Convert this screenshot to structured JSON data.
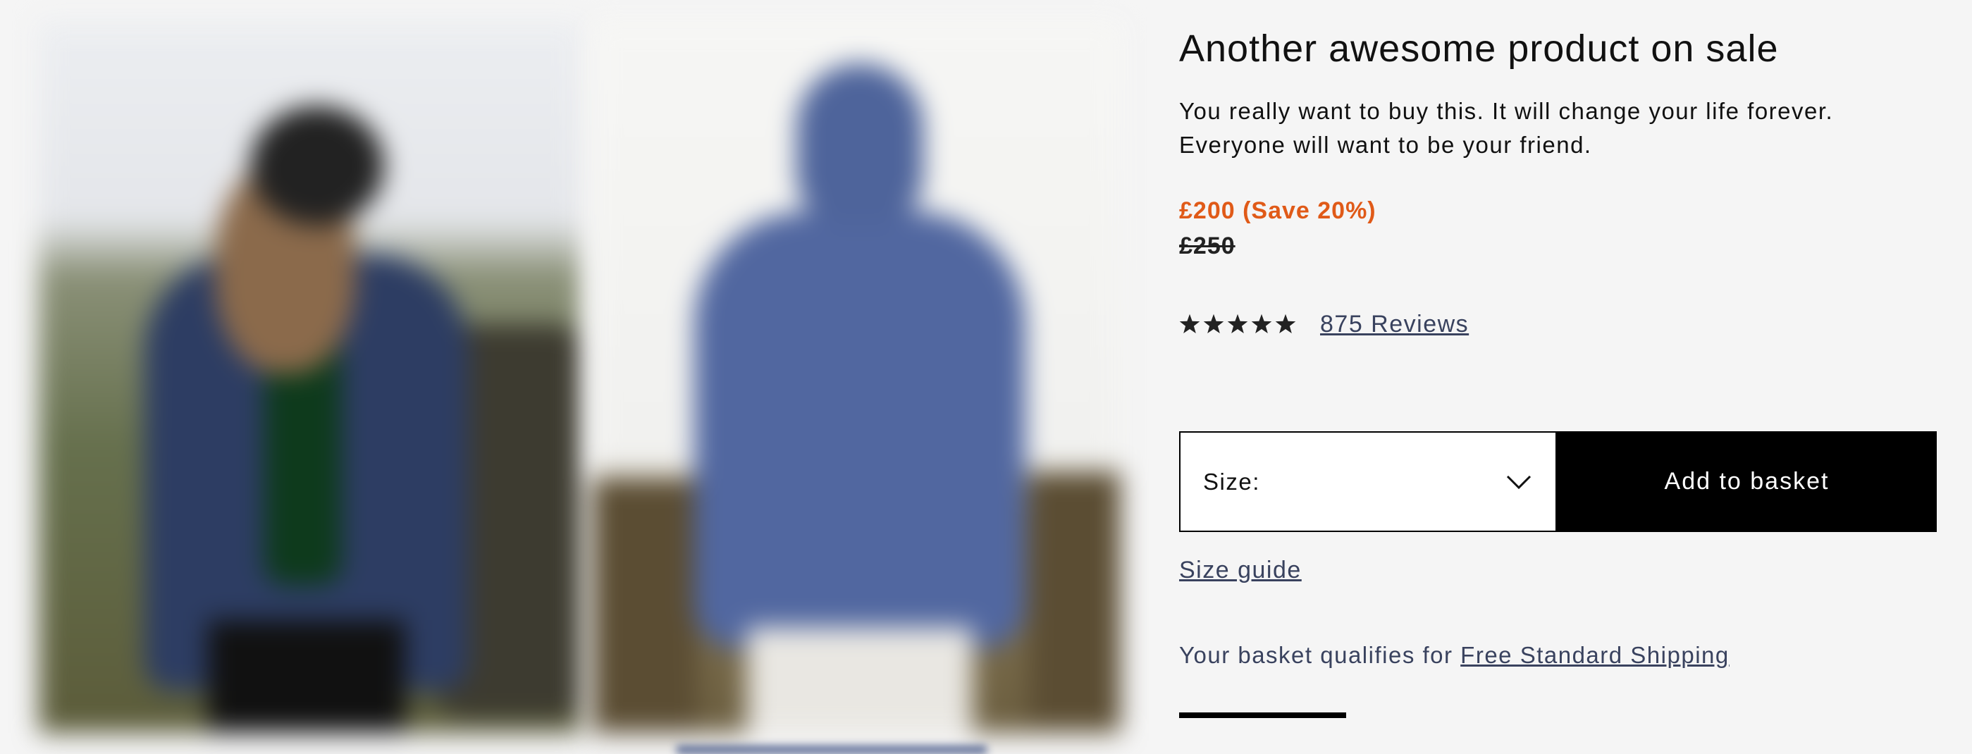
{
  "product": {
    "title": "Another awesome product on sale",
    "description_lines": [
      "You really want to buy this. It will change your life forever.",
      "Everyone will want to be your friend."
    ],
    "sale_price": "£200 (Save 20%)",
    "original_price": "£250"
  },
  "rating": {
    "stars": 5,
    "reviews_label": "875 Reviews",
    "star_color": "#222222"
  },
  "size_select": {
    "label": "Size:",
    "icon": "chevron-down-icon"
  },
  "add_to_basket_label": "Add to basket",
  "size_guide_label": "Size guide",
  "shipping": {
    "prefix": "Your basket qualifies for ",
    "link": "Free Standard Shipping",
    "progress": 0.22
  },
  "colors": {
    "sale_price": "#e05a18",
    "link": "#39425e",
    "button_bg": "#000000",
    "button_text": "#ffffff"
  }
}
